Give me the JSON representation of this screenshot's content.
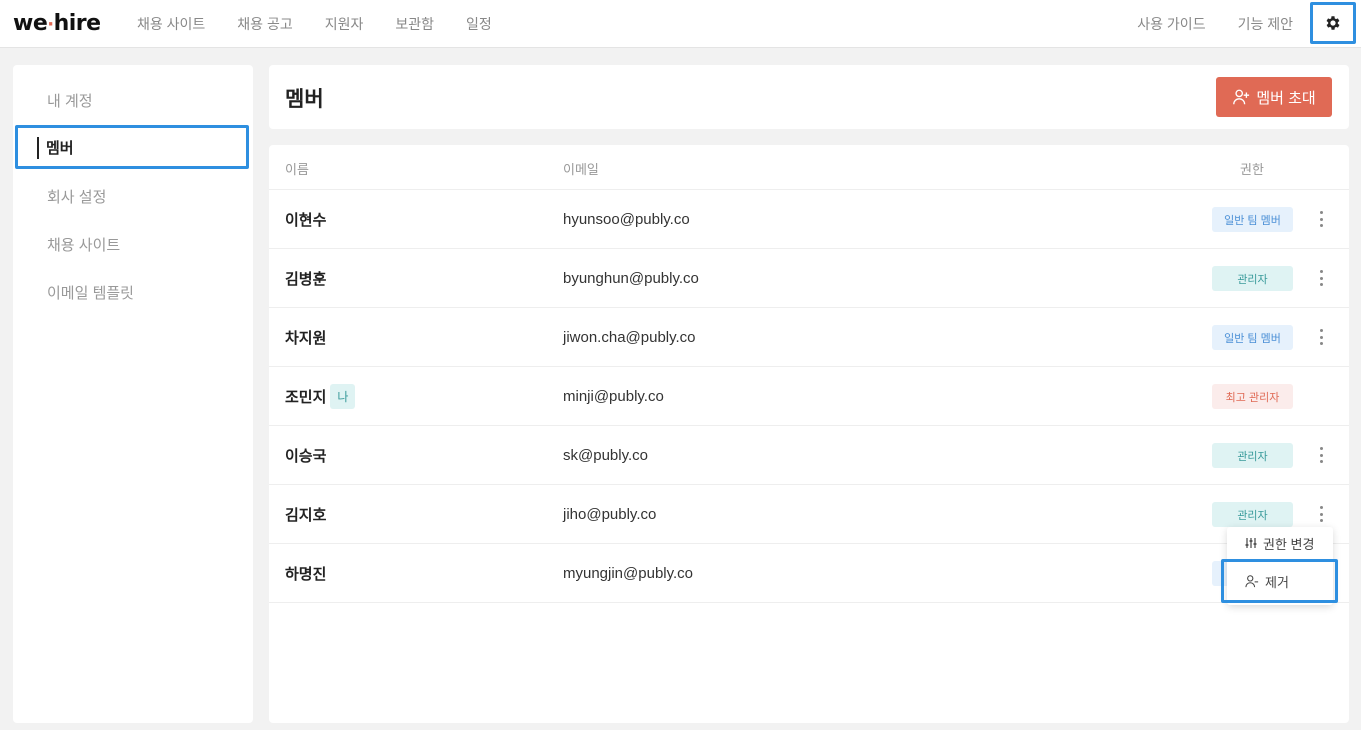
{
  "app": {
    "logo_left": "we",
    "logo_dot": "·",
    "logo_right": "hire"
  },
  "nav": {
    "left": [
      "채용 사이트",
      "채용 공고",
      "지원자",
      "보관함",
      "일정"
    ],
    "right": [
      "사용 가이드",
      "기능 제안"
    ],
    "settings_icon": "gear-icon"
  },
  "sidebar": {
    "items": [
      {
        "label": "내 계정",
        "active": false
      },
      {
        "label": "멤버",
        "active": true
      },
      {
        "label": "회사 설정",
        "active": false
      },
      {
        "label": "채용 사이트",
        "active": false
      },
      {
        "label": "이메일 템플릿",
        "active": false
      }
    ]
  },
  "header": {
    "title": "멤버",
    "invite_label": "멤버 초대",
    "invite_icon": "user-plus-icon",
    "accent": "#e06a55"
  },
  "table": {
    "columns": {
      "name": "이름",
      "email": "이메일",
      "role": "권한"
    },
    "rows": [
      {
        "name": "이현수",
        "email": "hyunsoo@publy.co",
        "role": "일반 팀 멤버",
        "role_type": "member",
        "me": false,
        "has_menu": true
      },
      {
        "name": "김병훈",
        "email": "byunghun@publy.co",
        "role": "관리자",
        "role_type": "admin",
        "me": false,
        "has_menu": true
      },
      {
        "name": "차지원",
        "email": "jiwon.cha@publy.co",
        "role": "일반 팀 멤버",
        "role_type": "member",
        "me": false,
        "has_menu": true
      },
      {
        "name": "조민지",
        "email": "minji@publy.co",
        "role": "최고 관리자",
        "role_type": "owner",
        "me": true,
        "me_label": "나",
        "has_menu": false
      },
      {
        "name": "이승국",
        "email": "sk@publy.co",
        "role": "관리자",
        "role_type": "admin",
        "me": false,
        "has_menu": true
      },
      {
        "name": "김지호",
        "email": "jiho@publy.co",
        "role": "관리자",
        "role_type": "admin",
        "me": false,
        "has_menu": true
      },
      {
        "name": "하명진",
        "email": "myungjin@publy.co",
        "role": "",
        "role_type": "member",
        "me": false,
        "has_menu": false
      }
    ]
  },
  "dropdown": {
    "items": [
      {
        "label": "권한 변경",
        "icon": "sliders-icon"
      },
      {
        "label": "제거",
        "icon": "user-minus-icon"
      }
    ]
  },
  "colors": {
    "highlight": "#2e8fe0",
    "member_badge": "#e6f1fc",
    "admin_badge": "#dff3f3",
    "owner_badge": "#fbeceb"
  }
}
